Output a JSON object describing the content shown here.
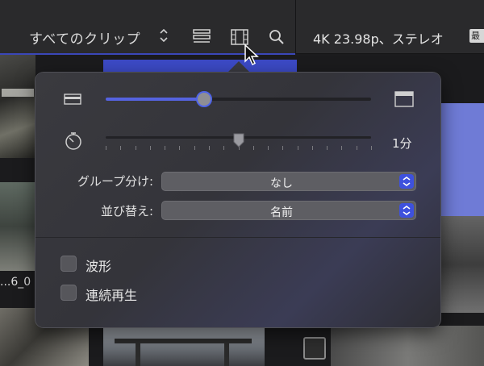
{
  "toolbar": {
    "clip_filter": "すべてのクリップ",
    "format_label": "4K 23.98p、ステレオ",
    "badge": "最"
  },
  "browser": {
    "clip_label": "...6_0"
  },
  "popover": {
    "clip_height_slider": {
      "value": 0.37
    },
    "duration_slider": {
      "value": 0.5,
      "label": "1分"
    },
    "group_by": {
      "label": "グループ分け:",
      "value": "なし"
    },
    "sort_by": {
      "label": "並び替え:",
      "value": "名前"
    },
    "waveforms": {
      "label": "波形",
      "checked": false
    },
    "continuous_playback": {
      "label": "連続再生",
      "checked": false
    }
  },
  "colors": {
    "accent": "#5563e0",
    "popover_bg": "#38383d"
  }
}
